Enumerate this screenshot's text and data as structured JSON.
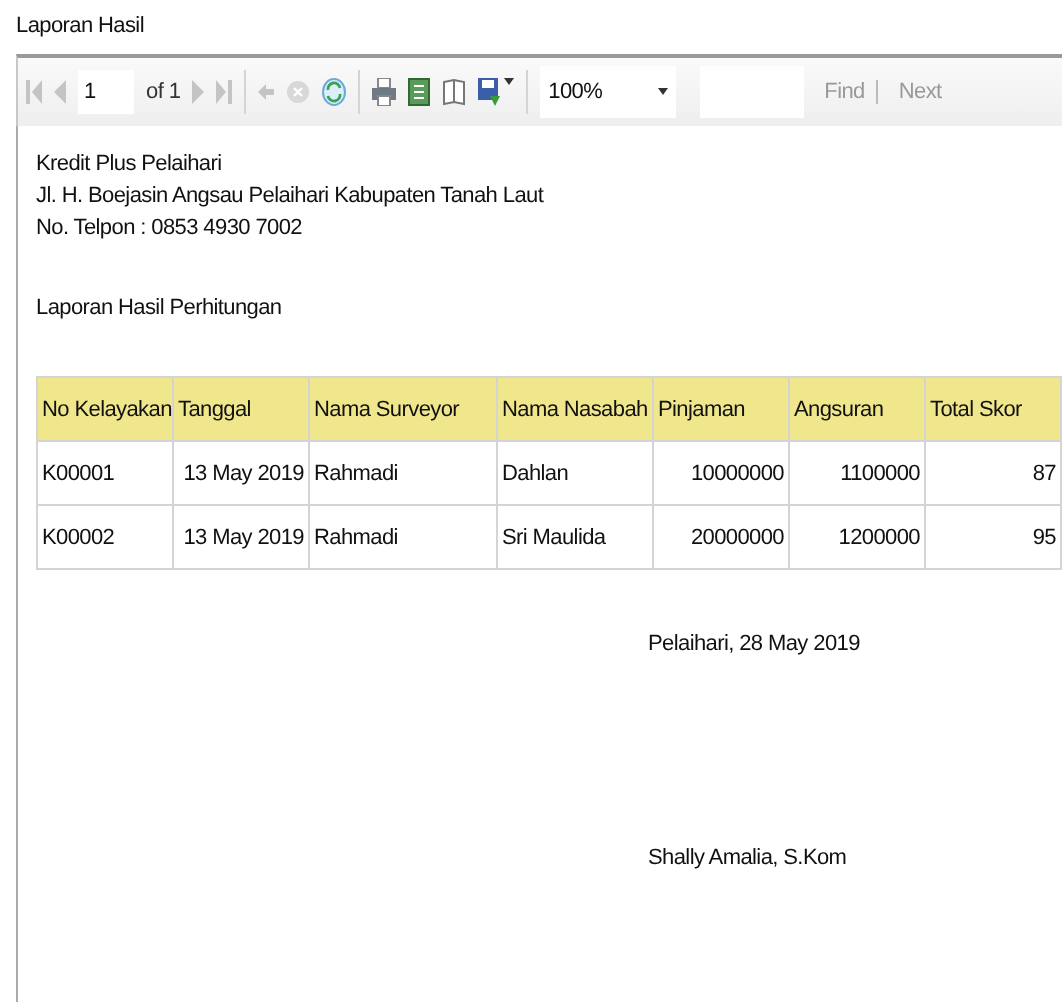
{
  "window": {
    "title": "Laporan Hasil"
  },
  "toolbar": {
    "page": "1",
    "page_count": "of 1",
    "zoom": "100%",
    "find_label": "Find",
    "next_label": "Next"
  },
  "report": {
    "header_lines": [
      "Kredit Plus Pelaihari",
      "Jl. H. Boejasin Angsau Pelaihari Kabupaten Tanah Laut",
      "No. Telpon : 0853 4930 7002"
    ],
    "title": "Laporan Hasil Perhitungan",
    "table": {
      "columns": [
        "No Kelayakan",
        "Tanggal",
        "Nama Surveyor",
        "Nama Nasabah",
        "Pinjaman",
        "Angsuran",
        "Total Skor"
      ],
      "rows": [
        [
          "K00001",
          "13 May 2019",
          "Rahmadi",
          "Dahlan",
          "10000000",
          "1100000",
          "87"
        ],
        [
          "K00002",
          "13 May 2019",
          "Rahmadi",
          "Sri Maulida",
          "20000000",
          "1200000",
          "95"
        ]
      ]
    },
    "place_date": "Pelaihari, 28 May 2019",
    "signatory": "Shally Amalia, S.Kom"
  }
}
